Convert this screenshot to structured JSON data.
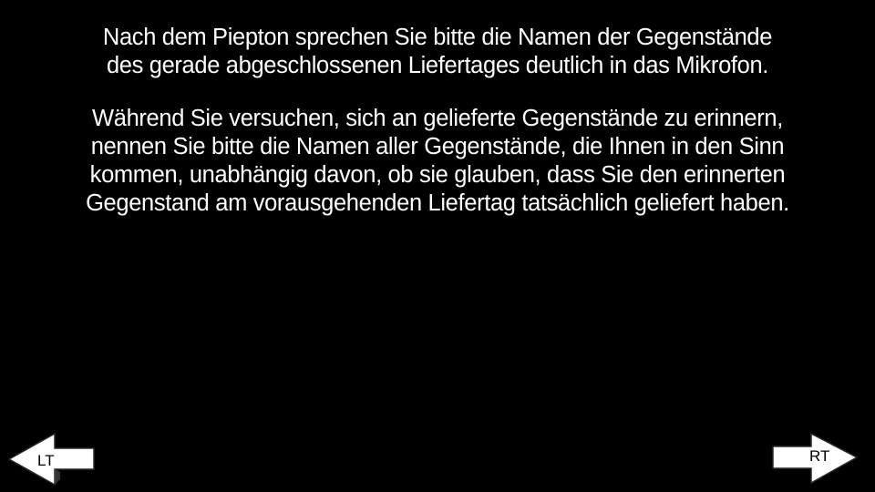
{
  "instructions": {
    "paragraph1": [
      "Nach dem Piepton sprechen Sie bitte die Namen der Gegenstände",
      "des gerade abgeschlossenen Liefertages deutlich in das Mikrofon."
    ],
    "paragraph2": [
      "Während Sie versuchen, sich an gelieferte Gegenstände zu erinnern,",
      "nennen Sie bitte die Namen aller Gegenstände, die Ihnen in den Sinn",
      "kommen, unabhängig davon, ob sie glauben, dass Sie den erinnerten",
      "Gegenstand am vorausgehenden Liefertag tatsächlich geliefert haben."
    ]
  },
  "navigation": {
    "left_label": "LT",
    "right_label": "RT"
  },
  "colors": {
    "background": "#000000",
    "text": "#ffffff",
    "arrow_fill": "#ffffff",
    "arrow_label": "#000000"
  },
  "icons": {
    "left": "arrow-left-icon",
    "right": "arrow-right-icon"
  }
}
